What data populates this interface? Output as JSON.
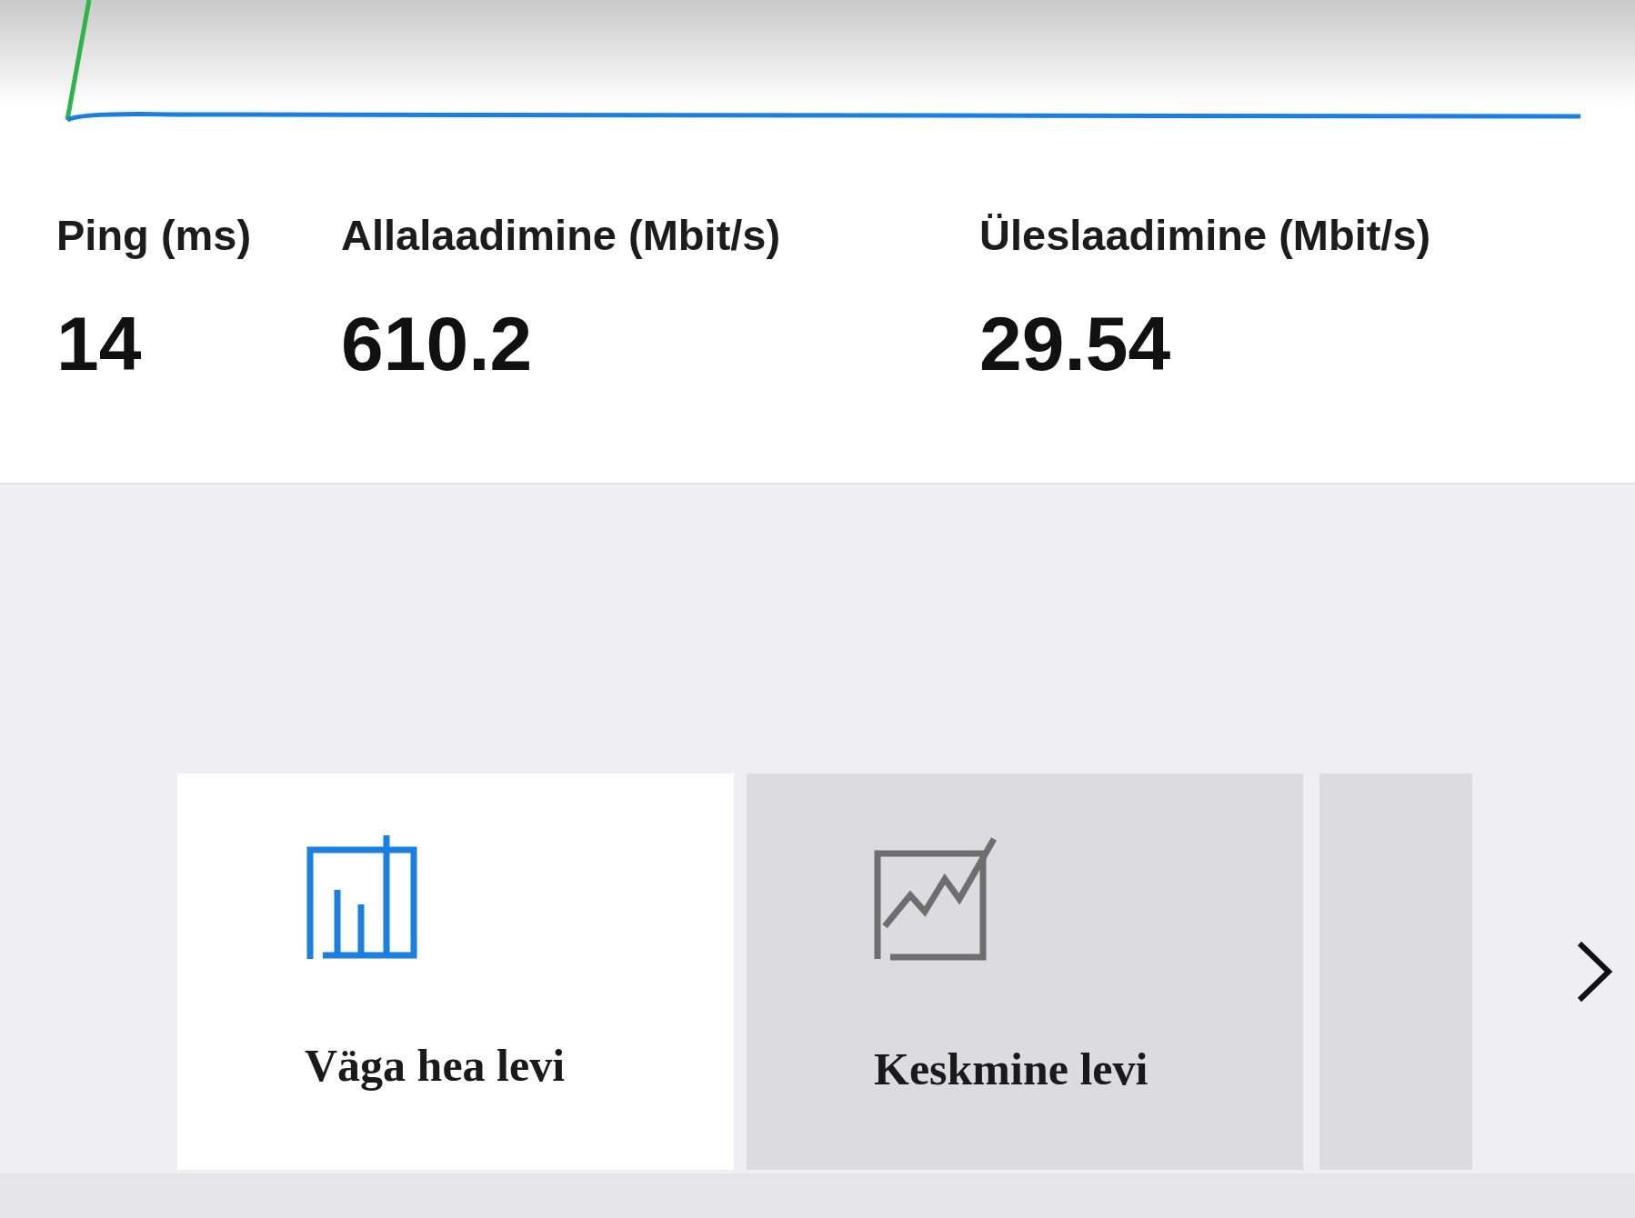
{
  "stats": [
    {
      "label": "Ping (ms)",
      "value": "14"
    },
    {
      "label": "Allalaadimine (Mbit/s)",
      "value": "610.2"
    },
    {
      "label": "Üleslaadimine (Mbit/s)",
      "value": "29.54"
    }
  ],
  "cards": [
    {
      "kind": "bars",
      "label": "Väga hea levi",
      "selected": true
    },
    {
      "kind": "trend",
      "label": "Keskmine levi",
      "selected": false
    }
  ]
}
